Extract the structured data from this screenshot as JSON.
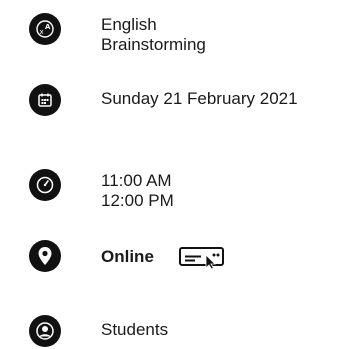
{
  "language": {
    "icon": "translate-icon",
    "primary": "English",
    "secondary": "Brainstorming"
  },
  "date": {
    "icon": "calendar-icon",
    "value": "Sunday 21 February 2021"
  },
  "time": {
    "icon": "clock-icon",
    "start": "11:00 AM",
    "end": "12:00 PM"
  },
  "location": {
    "icon": "location-pin-icon",
    "value": "Online",
    "action_icon": "online-link-icon"
  },
  "audience": {
    "icon": "person-icon",
    "value": "Students"
  }
}
